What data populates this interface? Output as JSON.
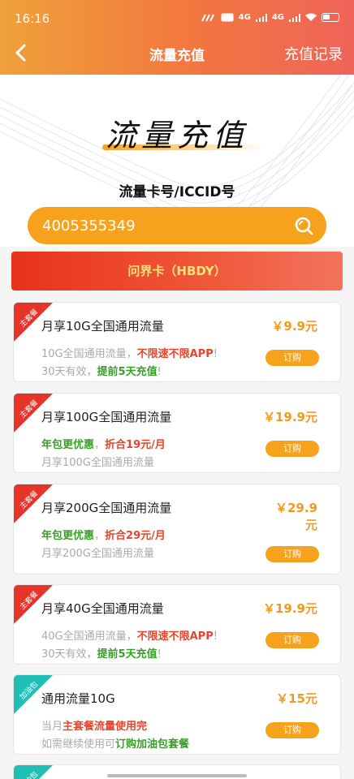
{
  "status": {
    "time": "16:16",
    "net1": "4G",
    "net2": "4G"
  },
  "nav": {
    "title": "流量充值",
    "right": "充值记录"
  },
  "hero": {
    "title": "流量充值",
    "label": "流量卡号/ICCID号"
  },
  "search": {
    "value": "4005355349"
  },
  "card_name": "问界卡（HBDY）",
  "colors": {
    "accent": "#f6a21c",
    "red": "#e8432b",
    "green": "#3a9d2a",
    "ribbon_red": "#e5342a",
    "ribbon_teal": "#1fbfb5"
  },
  "packages": [
    {
      "tag": "主套餐",
      "name": "月享10G全国通用流量",
      "price": "￥9.9元",
      "line1": [
        "10G全国通用流量，",
        "不限速不限APP",
        "!"
      ],
      "line2": [
        "30天有效，",
        "提前5天充值",
        "!"
      ],
      "buy": "订购"
    },
    {
      "tag": "主套餐",
      "name": "月享100G全国通用流量",
      "price": "￥19.9元",
      "line1": [
        "年包更优惠",
        "，",
        "折合19元/月"
      ],
      "line2": [
        "月享100G全国通用流量"
      ],
      "buy": "订购"
    },
    {
      "tag": "主套餐",
      "name": "月享200G全国通用流量",
      "price_a": "￥29.9",
      "price_b": "元",
      "line1": [
        "年包更优惠",
        "，",
        "折合29元/月"
      ],
      "line2": [
        "月享200G全国通用流量"
      ],
      "buy": "订购"
    },
    {
      "tag": "主套餐",
      "name": "月享40G全国通用流量",
      "price": "￥19.9元",
      "line1": [
        "40G全国通用流量，",
        "不限速不限APP",
        "!"
      ],
      "line2": [
        "30天有效，",
        "提前5天充值",
        "!"
      ],
      "buy": "订购"
    },
    {
      "tag": "加油包",
      "name": "通用流量10G",
      "price": "￥15元",
      "line1": [
        "当月",
        "主套餐流量使用完"
      ],
      "line2": [
        "如需继续使用可",
        "订购加油包套餐"
      ],
      "buy": "订购"
    },
    {
      "tag": "加油包"
    }
  ]
}
